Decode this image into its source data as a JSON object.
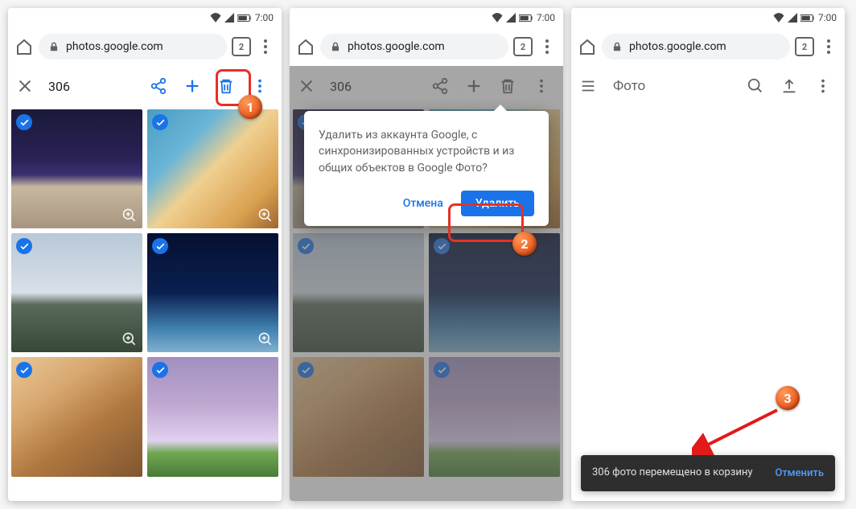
{
  "status": {
    "time": "7:00"
  },
  "chrome": {
    "url": "photos.google.com",
    "tab_count": "2"
  },
  "selection": {
    "count": "306"
  },
  "phone3": {
    "title": "Фото"
  },
  "dialog": {
    "text": "Удалить из аккаунта Google, с синхронизированных устройств и из общих объектов в Google Фото?",
    "cancel": "Отмена",
    "confirm": "Удалить"
  },
  "snackbar": {
    "text": "306 фото перемещено в корзину",
    "action": "Отменить"
  },
  "badges": {
    "one": "1",
    "two": "2",
    "three": "3"
  }
}
